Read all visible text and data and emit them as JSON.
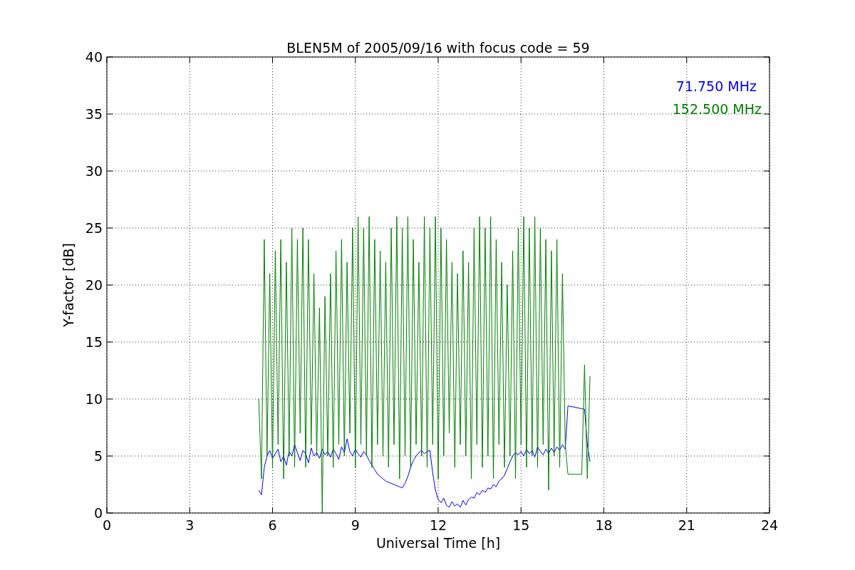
{
  "chart": {
    "chart_data": {
      "type": "line",
      "title": "BLEN5M of 2005/09/16 with focus code = 59",
      "xlabel": "Universal Time [h]",
      "ylabel": "Y-factor [dB]",
      "xlim": [
        0,
        24
      ],
      "ylim": [
        0,
        40
      ],
      "xticks": [
        0,
        3,
        6,
        9,
        12,
        15,
        18,
        21,
        24
      ],
      "yticks": [
        0,
        5,
        10,
        15,
        20,
        25,
        30,
        35,
        40
      ],
      "grid": true,
      "x": [
        5.5,
        5.6,
        5.7,
        5.8,
        5.9,
        6.0,
        6.1,
        6.2,
        6.3,
        6.4,
        6.5,
        6.6,
        6.7,
        6.8,
        6.9,
        7.0,
        7.1,
        7.2,
        7.3,
        7.4,
        7.5,
        7.6,
        7.7,
        7.8,
        7.9,
        8.0,
        8.1,
        8.2,
        8.3,
        8.4,
        8.5,
        8.6,
        8.7,
        8.8,
        8.9,
        9.0,
        9.1,
        9.2,
        9.3,
        9.4,
        9.5,
        9.6,
        9.7,
        9.8,
        9.9,
        10.0,
        10.1,
        10.2,
        10.3,
        10.4,
        10.5,
        10.6,
        10.7,
        10.8,
        10.9,
        11.0,
        11.1,
        11.2,
        11.3,
        11.4,
        11.5,
        11.6,
        11.7,
        11.8,
        11.9,
        12.0,
        12.1,
        12.2,
        12.3,
        12.4,
        12.5,
        12.6,
        12.7,
        12.8,
        12.9,
        13.0,
        13.1,
        13.2,
        13.3,
        13.4,
        13.5,
        13.6,
        13.7,
        13.8,
        13.9,
        14.0,
        14.1,
        14.2,
        14.3,
        14.4,
        14.5,
        14.6,
        14.7,
        14.8,
        14.9,
        15.0,
        15.1,
        15.2,
        15.3,
        15.4,
        15.5,
        15.6,
        15.7,
        15.8,
        15.9,
        16.0,
        16.1,
        16.2,
        16.3,
        16.4,
        16.5,
        16.6,
        16.7,
        16.8,
        16.9,
        17.0,
        17.1,
        17.2,
        17.3,
        17.4,
        17.5
      ],
      "series": [
        {
          "name": "71.750 MHz",
          "color": "#0000ff",
          "values": [
            2,
            1.6,
            4,
            5,
            5.5,
            4.8,
            5.2,
            5.6,
            4.5,
            5,
            4.2,
            5.4,
            5,
            6,
            5.3,
            4.6,
            5.5,
            5.2,
            4.4,
            5.7,
            5,
            5.3,
            4.8,
            5.6,
            5.1,
            5.4,
            4.9,
            5.6,
            5.2,
            4.7,
            5.8,
            5.3,
            6.5,
            5.4,
            5,
            5.6,
            5.2,
            4.9,
            5.4,
            5.1,
            4.6,
            4.2,
            3.8,
            3.4,
            3.2,
            3,
            2.8,
            2.7,
            2.6,
            2.5,
            2.4,
            2.3,
            2.2,
            2.6,
            3.2,
            4,
            4.6,
            5,
            5.3,
            5.5,
            5.2,
            5.4,
            5.5,
            3.5,
            2,
            1.2,
            0.9,
            1.3,
            0.7,
            0.5,
            1,
            0.6,
            0.8,
            0.5,
            1.1,
            0.7,
            1.2,
            1.4,
            1.3,
            1.8,
            1.6,
            2,
            1.8,
            2.2,
            2.1,
            2.5,
            2.3,
            2.8,
            3,
            3.3,
            3.9,
            4.5,
            5,
            5.3,
            5.1,
            5.4,
            5,
            5.6,
            5.2,
            5.5,
            4.9,
            5.8,
            5.4,
            5.1,
            5.6,
            5.2,
            5.7,
            5.3,
            5.8,
            5.5,
            6,
            5.6,
            9.4,
            9.35,
            9.3,
            9.25,
            9.2,
            9.15,
            9.1,
            6,
            4.5
          ]
        },
        {
          "name": "152.500 MHz",
          "color": "#008000",
          "values": [
            10,
            3,
            24,
            5,
            21,
            4,
            23,
            6,
            24,
            3,
            22,
            5,
            25,
            4,
            24,
            7,
            25,
            4,
            24,
            6,
            21,
            5,
            18,
            0,
            19,
            5,
            21,
            4,
            23,
            6,
            24,
            5,
            22,
            7,
            25,
            4,
            26,
            6,
            25,
            5,
            26,
            4,
            24,
            6,
            23,
            5,
            22,
            4,
            25,
            6,
            26,
            3,
            25,
            5,
            26,
            4,
            24,
            6,
            22,
            5,
            26,
            4,
            25,
            6,
            26,
            3,
            25,
            5,
            24,
            7,
            22,
            4,
            21,
            6,
            23,
            5,
            22,
            3,
            25,
            6,
            26,
            4,
            25,
            5,
            26,
            3,
            24,
            6,
            22,
            4,
            20,
            5,
            23,
            3,
            25,
            6,
            26,
            4,
            25,
            5,
            26,
            4,
            25,
            6,
            24,
            2,
            23,
            5,
            24,
            4,
            21,
            6,
            3.4,
            3.4,
            3.4,
            3.4,
            3.4,
            3.4,
            13,
            3,
            12
          ]
        }
      ]
    }
  }
}
